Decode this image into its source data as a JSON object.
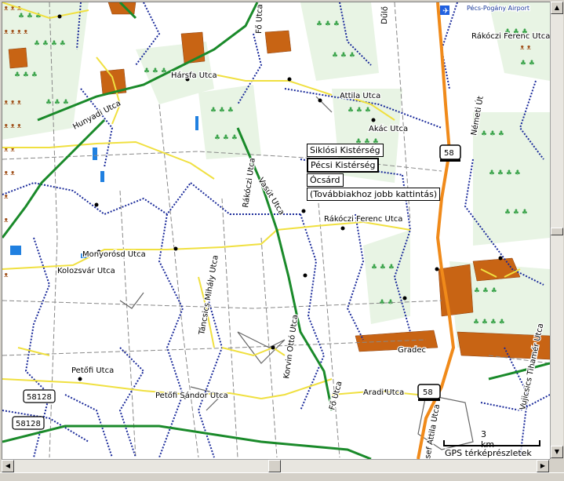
{
  "map": {
    "popup_items": [
      "Siklósi Kistérség",
      "Pécsi Kistérség",
      "Ócsárd",
      "(Továbbiakhoz jobb kattintás)"
    ],
    "scale_label": "3 km",
    "credit": "GPS térképrészletek",
    "labels": {
      "hunyadi": "Hunyadi Utca",
      "harsfa": "Hársfa Utca",
      "attila": "Attila Utca",
      "akac": "Akác Utca",
      "rakoczi_ferenc_top": "Rákóczi Ferenc Utca",
      "nemeti": "Németi Út",
      "rakoczi_utca": "Rákóczi Utca",
      "vasut": "Vasút Utca",
      "rakoczi_ferenc_mid": "Rákóczi Ferenc Utca",
      "monyorosd": "Monyorósd Utca",
      "kolozsvar": "Kolozsvár Utca",
      "tancsics": "Táncsics Mihály Utca",
      "kovin_otto": "Korvin Ottó Utca",
      "gradek": "Gradec",
      "petofi": "Petőfi Utca",
      "petofi_sandor": "Petőfi Sándor Utca",
      "fo_utca_bottom": "Fő Utca",
      "fo_utca_top": "Fő Utca",
      "aradi": "Aradi Utca",
      "jozsef_attila": "sef Attila Utca",
      "vujicsics": "Vujicsics Tihamér Utca",
      "airport": "Pécs-Pogány Airport",
      "dulo": "Dűlő"
    },
    "shields": {
      "r58_top": "58",
      "r58_bottom": "58",
      "r58128_a": "58128",
      "r58128_b": "58128"
    },
    "colors": {
      "forest_green": "#3aa34a",
      "main_road": "#1a8a2a",
      "minor_road": "#f0e040",
      "trunk": "#f08a1a",
      "boundary": "#1a2a9a",
      "urban": "#c86414"
    }
  }
}
